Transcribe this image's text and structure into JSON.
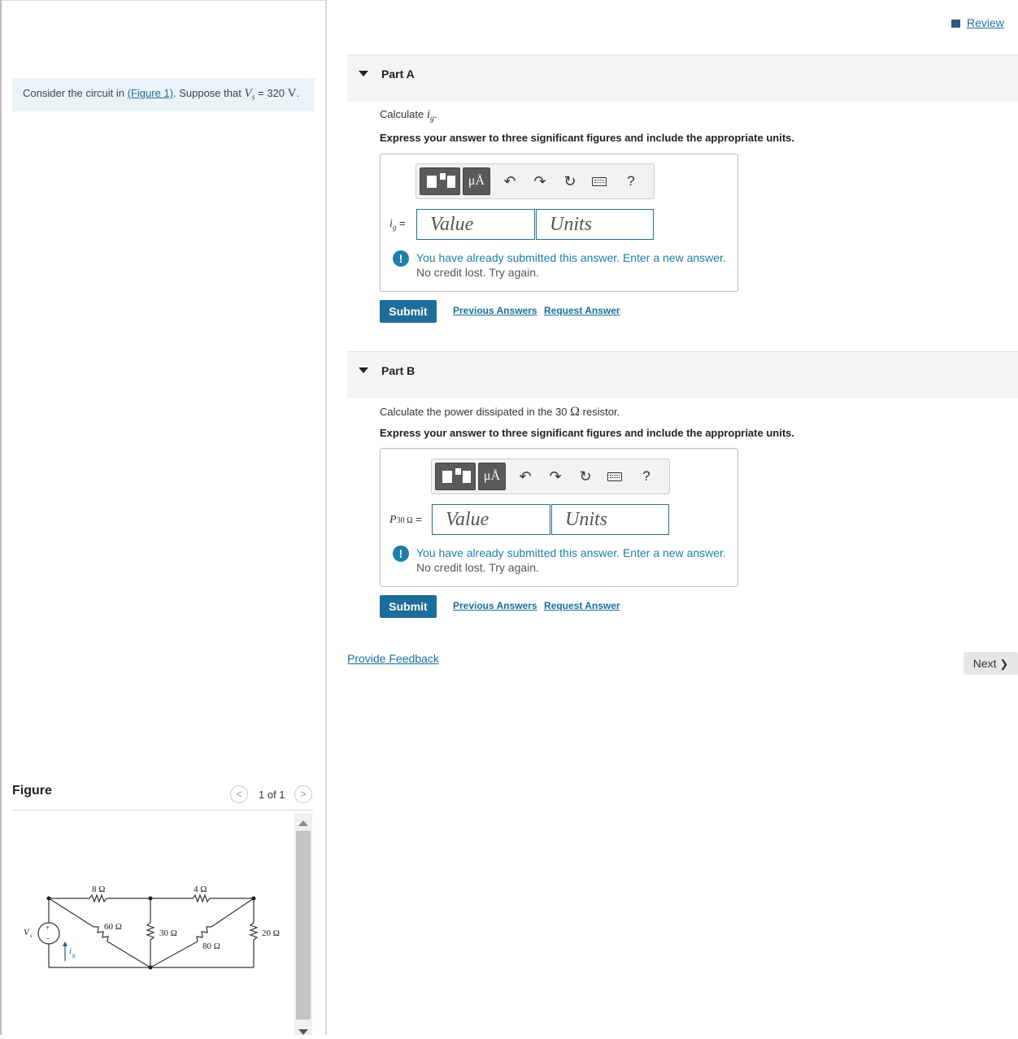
{
  "problem": {
    "text_pre": "Consider the circuit in ",
    "figure_link": "(Figure 1)",
    "text_mid": ". Suppose that ",
    "var_v": "V",
    "var_sub": "s",
    "text_eq": " = 320 ",
    "unit": "V",
    "text_end": "."
  },
  "figure": {
    "title": "Figure",
    "count": "1 of 1",
    "prev_icon": "<",
    "next_icon": ">",
    "circuit": {
      "r1": "8 Ω",
      "r2": "4 Ω",
      "r3": "60 Ω",
      "r4": "30 Ω",
      "r5": "80 Ω",
      "r6": "20 Ω",
      "source": "V",
      "source_sub": "s",
      "current": "i",
      "current_sub": "g",
      "plus": "+",
      "minus": "−"
    }
  },
  "header": {
    "review": "Review"
  },
  "partA": {
    "title": "Part A",
    "question_pre": "Calculate ",
    "question_var": "i",
    "question_sub": "g",
    "question_post": ".",
    "instructions": "Express your answer to three significant figures and include the appropriate units.",
    "var_label": "i",
    "var_sub": "g",
    "var_eq": " =",
    "value_placeholder": "Value",
    "units_placeholder": "Units",
    "warning_line1": "You have already submitted this answer. Enter a new answer.",
    "warning_line2": "No credit lost. Try again.",
    "submit": "Submit",
    "previous_answers": "Previous Answers",
    "request_answer": "Request Answer"
  },
  "partB": {
    "title": "Part B",
    "question_pre": "Calculate the power dissipated in the 30 ",
    "question_unit": "Ω",
    "question_post": " resistor.",
    "instructions": "Express your answer to three significant figures and include the appropriate units.",
    "var_label": "P",
    "var_sub": "30 Ω",
    "var_eq": " =",
    "value_placeholder": "Value",
    "units_placeholder": "Units",
    "warning_line1": "You have already submitted this answer. Enter a new answer.",
    "warning_line2": "No credit lost. Try again.",
    "submit": "Submit",
    "previous_answers": "Previous Answers",
    "request_answer": "Request Answer"
  },
  "toolbar": {
    "units_label": "μÅ",
    "undo_icon": "↶",
    "redo_icon": "↷",
    "reset_icon": "↻",
    "help_label": "?"
  },
  "footer": {
    "feedback": "Provide Feedback",
    "next": "Next",
    "next_icon": "❯"
  },
  "colors": {
    "accent": "#1c6e98",
    "link": "#1a6e9c",
    "problem_bg": "#eaf3f7",
    "part_bg": "#f4f4f4"
  }
}
